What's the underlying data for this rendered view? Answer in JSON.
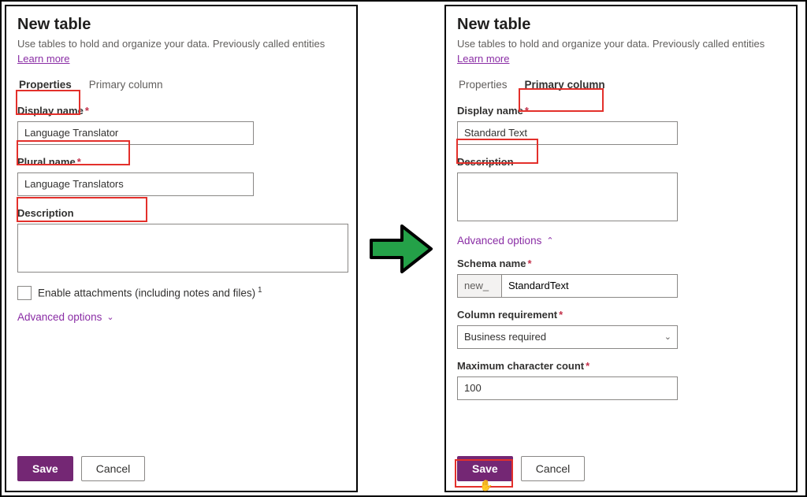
{
  "left": {
    "title": "New table",
    "subtext": "Use tables to hold and organize your data. Previously called entities",
    "learn_more": "Learn more",
    "tabs": {
      "properties": "Properties",
      "primary": "Primary column"
    },
    "display_name_label": "Display name",
    "display_name_value": "Language Translator",
    "plural_name_label": "Plural name",
    "plural_name_value": "Language Translators",
    "description_label": "Description",
    "enable_attachments": "Enable attachments (including notes and files)",
    "advanced_options": "Advanced options",
    "save": "Save",
    "cancel": "Cancel"
  },
  "right": {
    "title": "New table",
    "subtext": "Use tables to hold and organize your data. Previously called entities",
    "learn_more": "Learn more",
    "tabs": {
      "properties": "Properties",
      "primary": "Primary column"
    },
    "display_name_label": "Display name",
    "display_name_value": "Standard Text",
    "description_label": "Description",
    "advanced_options": "Advanced options",
    "schema_name_label": "Schema name",
    "schema_prefix": "new_",
    "schema_value": "StandardText",
    "column_req_label": "Column requirement",
    "column_req_value": "Business required",
    "max_char_label": "Maximum character count",
    "max_char_value": "100",
    "save": "Save",
    "cancel": "Cancel"
  }
}
